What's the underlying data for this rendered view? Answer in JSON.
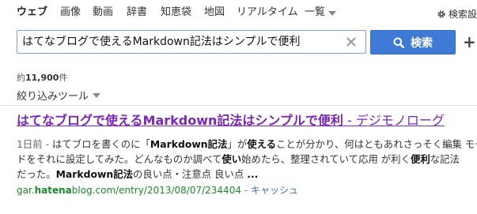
{
  "nav": {
    "tabs": [
      {
        "label": "ウェブ",
        "active": true
      },
      {
        "label": "画像"
      },
      {
        "label": "動画"
      },
      {
        "label": "辞書"
      },
      {
        "label": "知恵袋"
      },
      {
        "label": "地図"
      },
      {
        "label": "リアルタイム"
      },
      {
        "label": "一覧"
      }
    ],
    "settings_label": "検索設"
  },
  "search": {
    "query": "はてなブログで使えるMarkdown記法はシンプルで便利",
    "button_label": "検索"
  },
  "results_meta": {
    "count_prefix": "約",
    "count": "11,900",
    "count_suffix": "件",
    "filter_label": "絞り込みツール"
  },
  "result": {
    "title_part1": "はてなブログで使えるMarkdown記法はシンプルで便利",
    "title_part2": " - デジモノローグ",
    "snippet_line1_date": "1日前 - ",
    "snippet_line1_a": "はてブロを書くのに「",
    "snippet_line1_b": "Markdown記法",
    "snippet_line1_c": "」が",
    "snippet_line1_d": "使える",
    "snippet_line1_e": "ことが分かり、何はともあれさっそく編集 モー",
    "snippet_line2_a": "ドをそれに設定してみた。どんなものか調べて",
    "snippet_line2_b": "使い",
    "snippet_line2_c": "始めたら、整理されていて応用 が利く",
    "snippet_line2_d": "便利",
    "snippet_line2_e": "な記法",
    "snippet_line3_a": "だった。",
    "snippet_line3_b": "Markdown記法",
    "snippet_line3_c": "の良い点・注意点 良い点 ",
    "snippet_line3_d": "...",
    "url_a": "gar.",
    "url_b": "hatena",
    "url_c": "blog.com/entry/2013/08/07/234404",
    "url_sep": " - ",
    "cache_label": "キャッシュ"
  },
  "colors": {
    "visited_link": "#7a27b8",
    "url_green": "#1a8a2a",
    "search_button": "#3f7bd6"
  }
}
